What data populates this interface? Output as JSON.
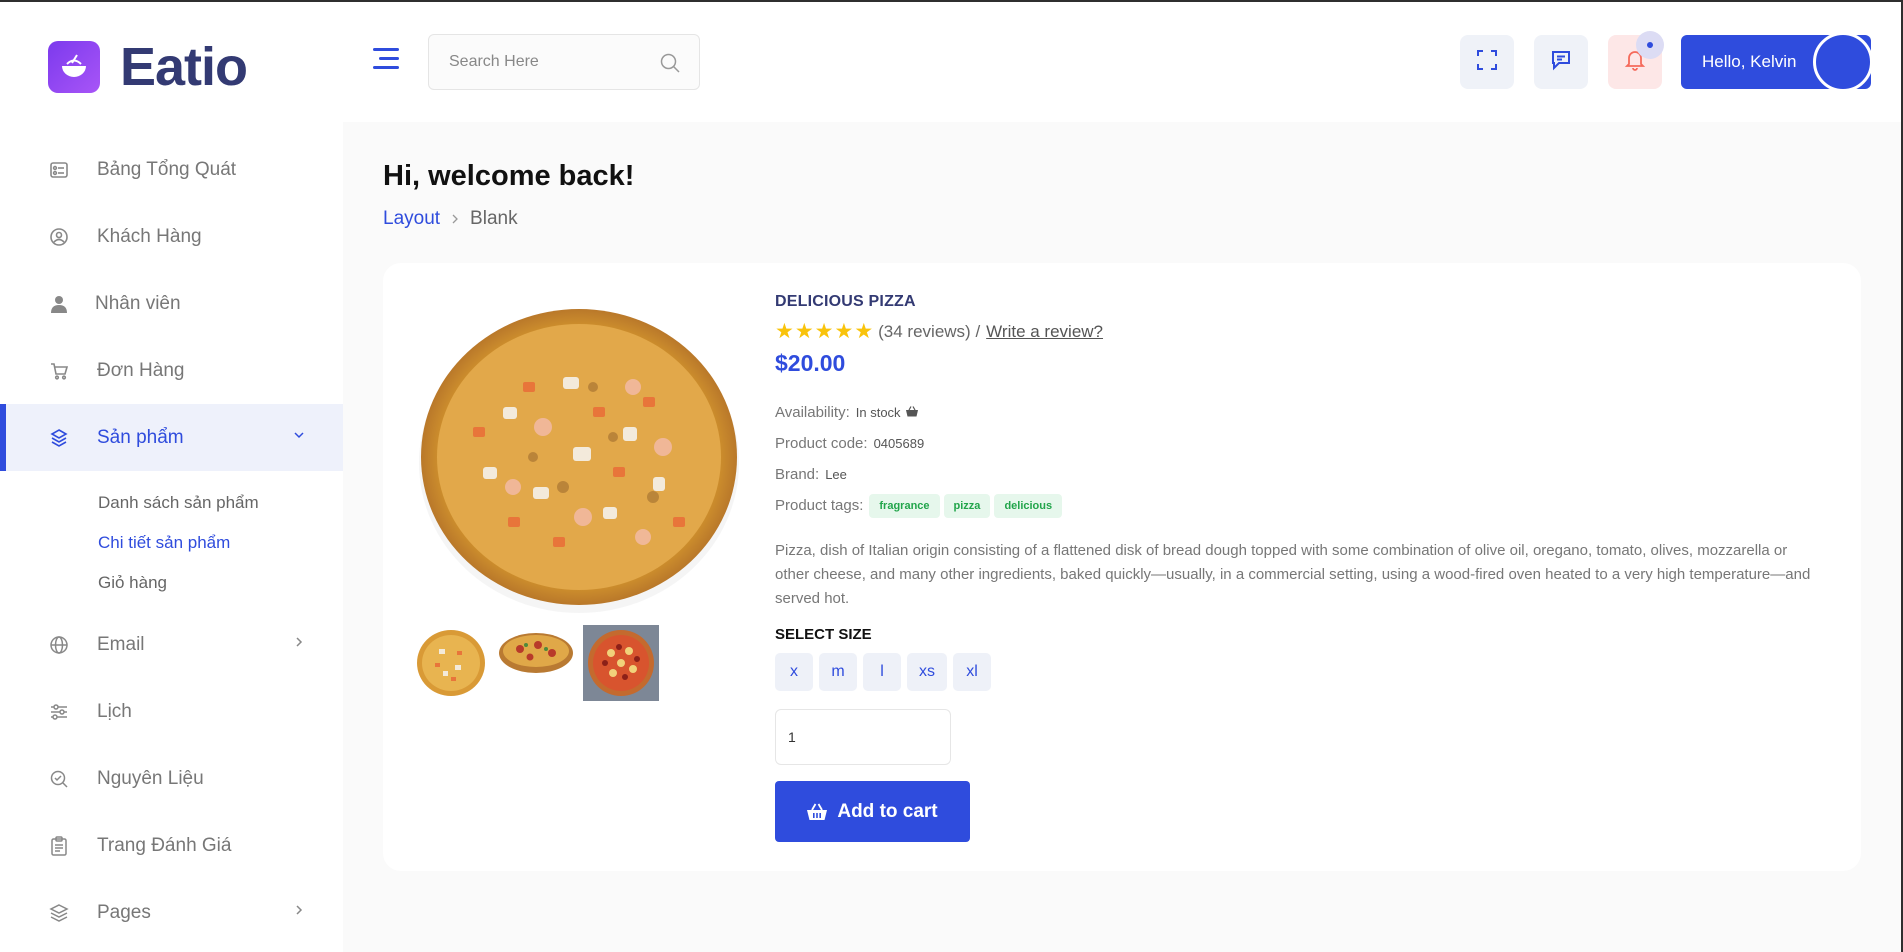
{
  "app": {
    "name": "Eatio"
  },
  "sidebar": {
    "items": [
      {
        "label": "Bảng Tổng Quát",
        "icon": "dashboard-icon"
      },
      {
        "label": "Khách Hàng",
        "icon": "customers-icon"
      },
      {
        "label": "Nhân viên",
        "icon": "user-icon"
      },
      {
        "label": "Đơn Hàng",
        "icon": "cart-icon"
      },
      {
        "label": "Sản phẩm",
        "icon": "products-icon",
        "active": true,
        "expanded": true
      },
      {
        "label": "Email",
        "icon": "globe-icon"
      },
      {
        "label": "Lịch",
        "icon": "sliders-icon"
      },
      {
        "label": "Nguyên Liệu",
        "icon": "ingredients-icon"
      },
      {
        "label": "Trang Đánh Giá",
        "icon": "clipboard-icon"
      },
      {
        "label": "Pages",
        "icon": "layers-icon"
      }
    ],
    "sub_items": [
      {
        "label": "Danh sách sản phẩm"
      },
      {
        "label": "Chi tiết sản phẩm",
        "active": true
      },
      {
        "label": "Giỏ hàng"
      }
    ]
  },
  "header": {
    "search_placeholder": "Search Here",
    "user_greeting": "Hello, Kelvin"
  },
  "page": {
    "welcome": "Hi, welcome back!",
    "breadcrumb": [
      "Layout",
      "Blank"
    ]
  },
  "product": {
    "title": "DELICIOUS PIZZA",
    "rating_stars": 5,
    "reviews": "(34 reviews) /",
    "write_review": "Write a review?",
    "price": "$20.00",
    "availability_label": "Availability:",
    "availability_value": "In stock",
    "code_label": "Product code:",
    "code_value": "0405689",
    "brand_label": "Brand:",
    "brand_value": "Lee",
    "tags_label": "Product tags:",
    "tags": [
      "fragrance",
      "pizza",
      "delicious"
    ],
    "description": "Pizza, dish of Italian origin consisting of a flattened disk of bread dough topped with some combination of olive oil, oregano, tomato, olives, mozzarella or other cheese, and many other ingredients, baked quickly—usually, in a commercial setting, using a wood-fired oven heated to a very high temperature—and served hot.",
    "size_title": "SELECT SIZE",
    "sizes": [
      "x",
      "m",
      "l",
      "xs",
      "xl"
    ],
    "quantity": "1",
    "add_to_cart": "Add to cart"
  },
  "colors": {
    "accent": "#2f4cdd",
    "brand_text": "#333a73",
    "star": "#f9c30b",
    "tag_green": "#22a54b"
  }
}
